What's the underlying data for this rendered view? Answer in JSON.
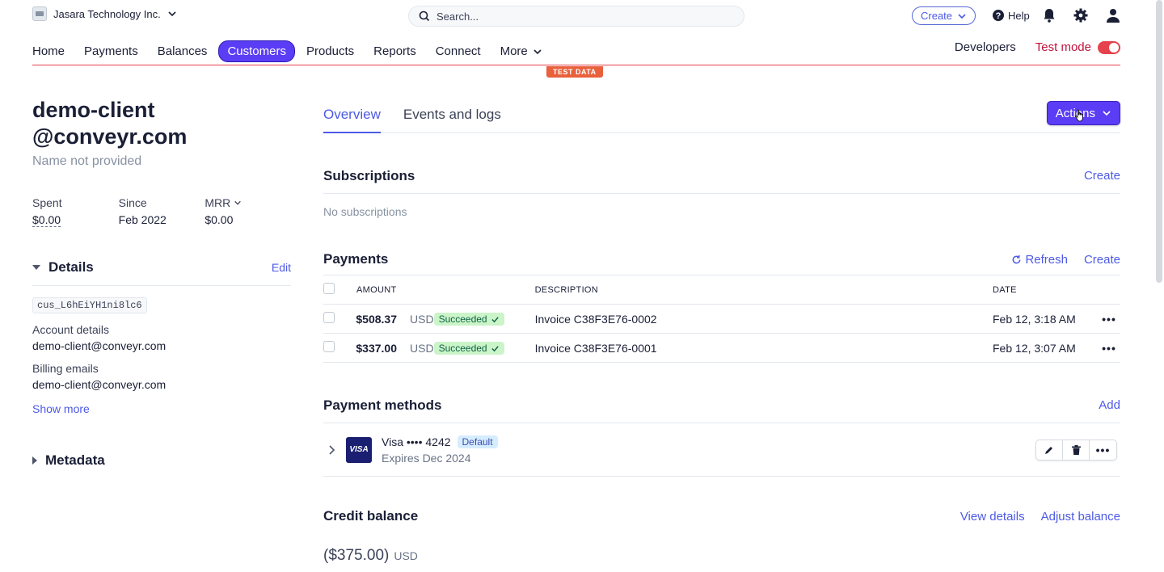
{
  "topbar": {
    "account_name": "Jasara Technology Inc.",
    "search_placeholder": "Search...",
    "create_label": "Create",
    "help_label": "Help"
  },
  "nav": {
    "items": [
      {
        "label": "Home"
      },
      {
        "label": "Payments"
      },
      {
        "label": "Balances"
      },
      {
        "label": "Customers"
      },
      {
        "label": "Products"
      },
      {
        "label": "Reports"
      },
      {
        "label": "Connect"
      },
      {
        "label": "More"
      }
    ],
    "active": "Customers",
    "developers_label": "Developers",
    "test_mode_label": "Test mode",
    "test_mode_on": true,
    "test_data_label": "TEST DATA"
  },
  "customer": {
    "email_line1": "demo-client",
    "email_line2": "@conveyr.com",
    "name": "Name not provided",
    "stats": {
      "spent_label": "Spent",
      "spent_value": "$0.00",
      "since_label": "Since",
      "since_value": "Feb 2022",
      "mrr_label": "MRR",
      "mrr_value": "$0.00"
    },
    "details": {
      "title": "Details",
      "edit_label": "Edit",
      "id": "cus_L6hEiYH1ni8lc6",
      "account_details_label": "Account details",
      "account_details_value": "demo-client@conveyr.com",
      "billing_emails_label": "Billing emails",
      "billing_emails_value": "demo-client@conveyr.com",
      "show_more_label": "Show more"
    },
    "metadata_title": "Metadata"
  },
  "tabs": {
    "overview": "Overview",
    "events": "Events and logs",
    "actions_label": "Actions"
  },
  "subscriptions": {
    "title": "Subscriptions",
    "create_label": "Create",
    "empty": "No subscriptions"
  },
  "payments": {
    "title": "Payments",
    "refresh_label": "Refresh",
    "create_label": "Create",
    "columns": {
      "amount": "Amount",
      "description": "Description",
      "date": "Date"
    },
    "rows": [
      {
        "amount": "$508.37",
        "currency": "USD",
        "status": "Succeeded",
        "description": "Invoice C38F3E76-0002",
        "date": "Feb 12, 3:18 AM"
      },
      {
        "amount": "$337.00",
        "currency": "USD",
        "status": "Succeeded",
        "description": "Invoice C38F3E76-0001",
        "date": "Feb 12, 3:07 AM"
      }
    ]
  },
  "payment_methods": {
    "title": "Payment methods",
    "add_label": "Add",
    "card": {
      "brand_logo": "VISA",
      "name": "Visa •••• 4242",
      "badge": "Default",
      "expires": "Expires Dec 2024"
    }
  },
  "credit_balance": {
    "title": "Credit balance",
    "view_details_label": "View details",
    "adjust_label": "Adjust balance",
    "amount": "($375.00)",
    "currency": "USD"
  },
  "colors": {
    "accent": "#5a3df5",
    "link": "#4d5ae5",
    "test_mode": "#e5424d",
    "success_bg": "#cbf4c9"
  }
}
